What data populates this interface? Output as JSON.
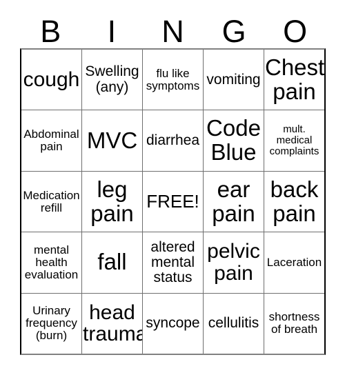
{
  "card": {
    "title": "BINGO",
    "header_letters": [
      "B",
      "I",
      "N",
      "G",
      "O"
    ],
    "colors": {
      "background": "#ffffff",
      "text": "#000000",
      "grid_line": "#6e6e6e",
      "outer_border": "#808080"
    },
    "grid": {
      "columns": 5,
      "rows": 5,
      "free_space": {
        "row": 3,
        "column": 3,
        "label": "FREE!"
      }
    },
    "rows": [
      {
        "cells": [
          {
            "label": "cough"
          },
          {
            "label": "Swelling\n(any)"
          },
          {
            "label": "flu like\nsymptoms"
          },
          {
            "label": "vomiting"
          },
          {
            "label": "Chest\npain"
          }
        ]
      },
      {
        "cells": [
          {
            "label": "Abdominal\npain"
          },
          {
            "label": "MVC"
          },
          {
            "label": "diarrhea"
          },
          {
            "label": "Code\nBlue"
          },
          {
            "label": "mult.\nmedical\ncomplaints"
          }
        ]
      },
      {
        "cells": [
          {
            "label": "Medication\nrefill"
          },
          {
            "label": "leg\npain"
          },
          {
            "label": "FREE!"
          },
          {
            "label": "ear\npain"
          },
          {
            "label": "back\npain"
          }
        ]
      },
      {
        "cells": [
          {
            "label": "mental\nhealth\nevaluation"
          },
          {
            "label": "fall"
          },
          {
            "label": "altered\nmental\nstatus"
          },
          {
            "label": "pelvic\npain"
          },
          {
            "label": "Laceration"
          }
        ]
      },
      {
        "cells": [
          {
            "label": "Urinary\nfrequency\n(burn)"
          },
          {
            "label": "head\ntrauma"
          },
          {
            "label": "syncope"
          },
          {
            "label": "cellulitis"
          },
          {
            "label": "shortness\nof breath"
          }
        ]
      }
    ]
  }
}
